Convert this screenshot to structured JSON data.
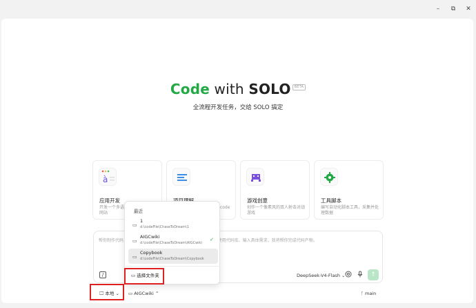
{
  "window": {
    "minimize": "–",
    "maximize": "⧉",
    "close": "✕"
  },
  "hero": {
    "code": "Code",
    "with": " with ",
    "solo": "SOLO",
    "beta": "BETA",
    "subtitle": "全流程开发任务，交给 SOLO 搞定"
  },
  "cards": [
    {
      "title": "应用开发",
      "desc": "开发一个多语言的 Web 应用或网站",
      "icon": "app-dev-icon"
    },
    {
      "title": "项目理解",
      "desc": "深度理解代码仓库，解读 code",
      "icon": "project-icon"
    },
    {
      "title": "游戏创意",
      "desc": "创作一个像素风的双人射击对战游戏",
      "icon": "game-icon"
    },
    {
      "title": "工具脚本",
      "desc": "编写自动化脚本工具，采集并处理数据",
      "icon": "tool-icon"
    }
  ],
  "input": {
    "placeholder": "帮你制作代码，可以 / 调用工具、@ 引用文件、# 引用目录、@ 使用代码库、输入具体需求，我将帮你完成代码产物。",
    "slash": "/",
    "model": "DeepSeek-V4-Flash"
  },
  "bottom": {
    "local": "本地",
    "project": "AIGCwiki",
    "branch": "main"
  },
  "dropdown": {
    "header": "最近",
    "items": [
      {
        "name": "1",
        "path": "d:\\codeFile\\ChaseToDream\\1"
      },
      {
        "name": "AIGCwiki",
        "path": "d:\\codeFile\\ChaseToDream\\AIGCwiki"
      },
      {
        "name": "Copybook",
        "path": "d:\\codeFile\\ChaseToDream\\Copybook"
      }
    ],
    "choose": "选择文件夹"
  },
  "colors": {
    "accent": "#22a845",
    "highlight": "#e02020"
  }
}
